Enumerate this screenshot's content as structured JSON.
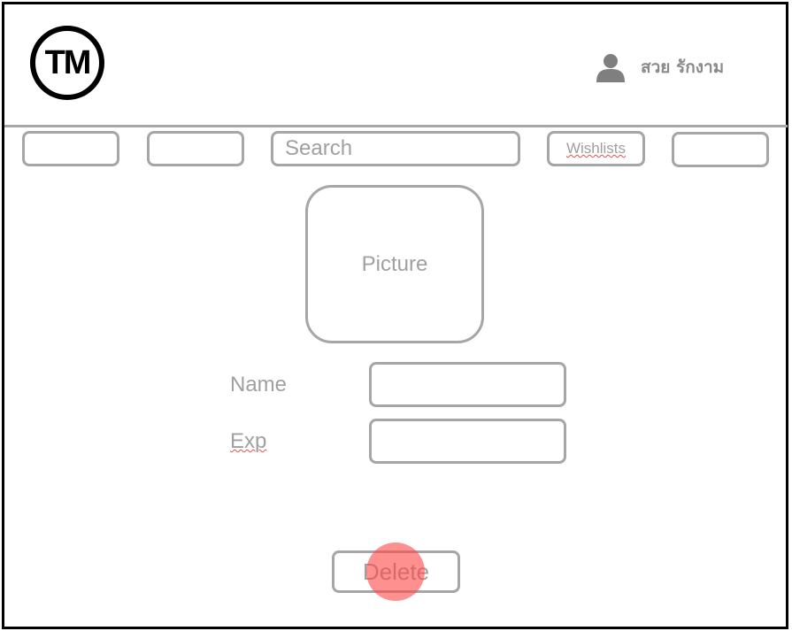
{
  "header": {
    "logo_text": "TM",
    "user_icon": "user-icon",
    "user_name": "สวย รักงาม"
  },
  "nav": {
    "search_label": "Search",
    "wishlists_label": "Wishlists"
  },
  "item": {
    "picture_label": "Picture",
    "name_label": "Name",
    "name_value": "",
    "exp_label": "Exp",
    "exp_value": ""
  },
  "actions": {
    "delete_label": "Delete"
  },
  "colors": {
    "outline": "#a6a6a6",
    "text": "#a0a0a0",
    "click_indicator": "#ff4646"
  }
}
